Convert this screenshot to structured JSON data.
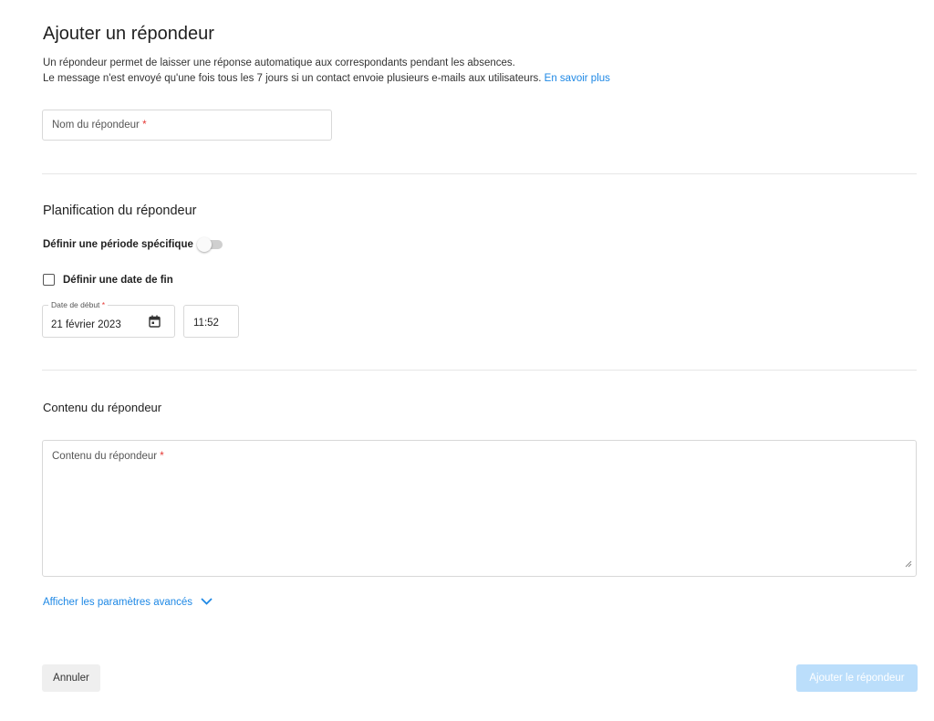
{
  "header": {
    "title": "Ajouter un répondeur",
    "description_line1": "Un répondeur permet de laisser une réponse automatique aux correspondants pendant les absences.",
    "description_line2": "Le message n'est envoyé qu'une fois tous les 7 jours si un contact envoie plusieurs e-mails aux utilisateurs.",
    "learn_more": "En savoir plus"
  },
  "name_field": {
    "label": "Nom du répondeur",
    "required_mark": "*",
    "value": ""
  },
  "schedule": {
    "title": "Planification du répondeur",
    "period_label": "Définir une période spécifique",
    "period_enabled": false,
    "end_date_label": "Définir une date de fin",
    "end_date_checked": false,
    "start_date_label": "Date de début",
    "required_mark": "*",
    "start_date_value": "21 février 2023",
    "start_time_value": "11:52"
  },
  "content": {
    "title": "Contenu du répondeur",
    "field_label": "Contenu du répondeur",
    "required_mark": "*",
    "value": ""
  },
  "advanced": {
    "label": "Afficher les paramètres avancés"
  },
  "footer": {
    "cancel_label": "Annuler",
    "submit_label": "Ajouter le répondeur",
    "submit_enabled": false
  },
  "colors": {
    "accent": "#1e88e5",
    "required": "#e53935",
    "submit_disabled_bg": "#bbdefb",
    "cancel_bg": "#efefef"
  },
  "icons": {
    "date_picker": "calendar-icon",
    "advanced_toggle": "chevron-down-icon",
    "textarea_resize": "resize-handle-icon"
  }
}
